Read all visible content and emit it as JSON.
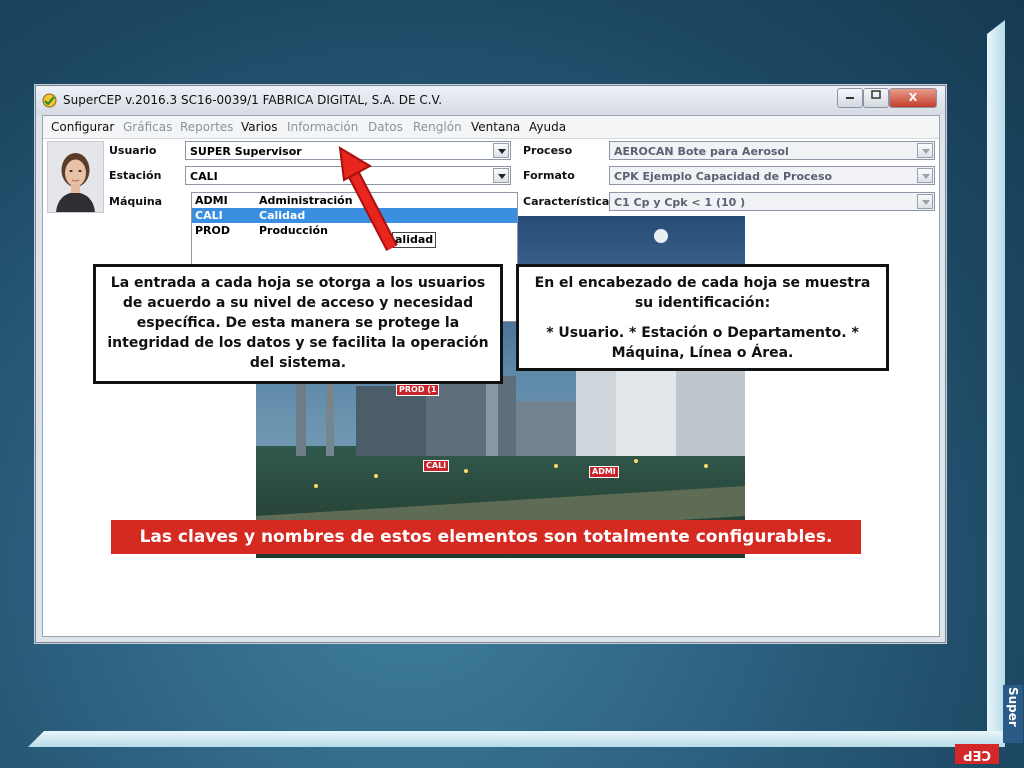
{
  "window": {
    "title": "SuperCEP v.2016.3  SC16-0039/1  FABRICA DIGITAL, S.A. DE C.V.",
    "min_icon": "minimize-icon",
    "max_icon": "maximize-icon",
    "close_label": "X"
  },
  "menu": [
    {
      "label": "Configurar",
      "enabled": true
    },
    {
      "label": "Gráficas",
      "enabled": false
    },
    {
      "label": "Reportes",
      "enabled": false
    },
    {
      "label": "Varios",
      "enabled": true
    },
    {
      "label": "Información",
      "enabled": false
    },
    {
      "label": "Datos",
      "enabled": false
    },
    {
      "label": "Renglón",
      "enabled": false
    },
    {
      "label": "Ventana",
      "enabled": true
    },
    {
      "label": "Ayuda",
      "enabled": true
    }
  ],
  "fields": {
    "usuario_label": "Usuario",
    "usuario_value": "SUPER  Supervisor",
    "estacion_label": "Estación",
    "estacion_value": "CALI",
    "maquina_label": "Máquina",
    "proceso_label": "Proceso",
    "proceso_value": "AEROCAN  Bote para Aerosol",
    "formato_label": "Formato",
    "formato_value": "CPK  Ejemplo Capacidad de Proceso",
    "caracteristica_label": "Característica",
    "caracteristica_value": "C1  Cp y Cpk < 1 (10 )"
  },
  "station_list": [
    {
      "code": "ADMI",
      "name": "Administración",
      "selected": false
    },
    {
      "code": "CALI",
      "name": "Calidad",
      "selected": true
    },
    {
      "code": "PROD",
      "name": "Producción",
      "selected": false
    }
  ],
  "callout_label": "alidad",
  "factory_tags": {
    "prod": "PROD  (1",
    "cali": "CALI",
    "admi": "ADMI"
  },
  "notes": {
    "left": "La entrada a cada hoja se otorga a los usuarios de acuerdo a su nivel de acceso y necesidad específica. De esta manera se protege la integridad de los datos y se facilita la operación del sistema.",
    "right_line1": "En el encabezado de cada hoja se muestra su identificación:",
    "right_line2": "* Usuario. * Estación o Departamento. * Máquina, Línea o Área."
  },
  "banner": "Las claves y nombres de estos elementos son totalmente configurables.",
  "brand": {
    "super": "Super",
    "cep": "CEP"
  },
  "colors": {
    "accent_red": "#d52a22",
    "selection_blue": "#3a8ee0",
    "brand_blue": "#2a5b86"
  }
}
